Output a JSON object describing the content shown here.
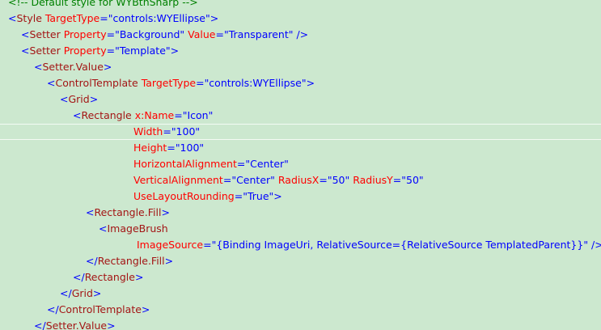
{
  "editor": {
    "colors": {
      "background": "#cce8cf",
      "comment": "#008000",
      "bracket": "#0000ff",
      "tag": "#a31515",
      "attribute": "#ff0000",
      "value": "#0000ff",
      "current_line_border": "#f4fbf4"
    },
    "current_line_index": 8,
    "lines": [
      {
        "indent": 10,
        "tokens": [
          [
            "comment",
            "<!-- Default style for WYBtnSharp -->"
          ]
        ]
      },
      {
        "indent": 10,
        "tokens": [
          [
            "bracket",
            "<"
          ],
          [
            "tag",
            "Style"
          ],
          [
            "attr",
            " TargetType"
          ],
          [
            "bracket",
            "="
          ],
          [
            "value",
            "\"controls:WYEllipse\""
          ],
          [
            "bracket",
            ">"
          ]
        ]
      },
      {
        "indent": 26,
        "tokens": [
          [
            "bracket",
            "<"
          ],
          [
            "tag",
            "Setter"
          ],
          [
            "attr",
            " Property"
          ],
          [
            "bracket",
            "="
          ],
          [
            "value",
            "\"Background\""
          ],
          [
            "attr",
            " Value"
          ],
          [
            "bracket",
            "="
          ],
          [
            "value",
            "\"Transparent\""
          ],
          [
            "bracket",
            " />"
          ]
        ]
      },
      {
        "indent": 26,
        "tokens": [
          [
            "bracket",
            "<"
          ],
          [
            "tag",
            "Setter"
          ],
          [
            "attr",
            " Property"
          ],
          [
            "bracket",
            "="
          ],
          [
            "value",
            "\"Template\""
          ],
          [
            "bracket",
            ">"
          ]
        ]
      },
      {
        "indent": 42,
        "tokens": [
          [
            "bracket",
            "<"
          ],
          [
            "tag",
            "Setter.Value"
          ],
          [
            "bracket",
            ">"
          ]
        ]
      },
      {
        "indent": 58,
        "tokens": [
          [
            "bracket",
            "<"
          ],
          [
            "tag",
            "ControlTemplate"
          ],
          [
            "attr",
            " TargetType"
          ],
          [
            "bracket",
            "="
          ],
          [
            "value",
            "\"controls:WYEllipse\""
          ],
          [
            "bracket",
            ">"
          ]
        ]
      },
      {
        "indent": 74,
        "tokens": [
          [
            "bracket",
            "<"
          ],
          [
            "tag",
            "Grid"
          ],
          [
            "bracket",
            ">"
          ]
        ]
      },
      {
        "indent": 90,
        "tokens": [
          [
            "bracket",
            "<"
          ],
          [
            "tag",
            "Rectangle"
          ],
          [
            "attr",
            " x:Name"
          ],
          [
            "bracket",
            "="
          ],
          [
            "value",
            "\"Icon\""
          ]
        ]
      },
      {
        "indent": 165,
        "tokens": [
          [
            "attr",
            "Width"
          ],
          [
            "bracket",
            "="
          ],
          [
            "value",
            "\"100\""
          ]
        ]
      },
      {
        "indent": 165,
        "tokens": [
          [
            "attr",
            "Height"
          ],
          [
            "bracket",
            "="
          ],
          [
            "value",
            "\"100\""
          ]
        ]
      },
      {
        "indent": 165,
        "tokens": [
          [
            "attr",
            "HorizontalAlignment"
          ],
          [
            "bracket",
            "="
          ],
          [
            "value",
            "\"Center\""
          ]
        ]
      },
      {
        "indent": 165,
        "tokens": [
          [
            "attr",
            "VerticalAlignment"
          ],
          [
            "bracket",
            "="
          ],
          [
            "value",
            "\"Center\""
          ],
          [
            "attr",
            " RadiusX"
          ],
          [
            "bracket",
            "="
          ],
          [
            "value",
            "\"50\""
          ],
          [
            "attr",
            " RadiusY"
          ],
          [
            "bracket",
            "="
          ],
          [
            "value",
            "\"50\""
          ]
        ]
      },
      {
        "indent": 165,
        "tokens": [
          [
            "attr",
            "UseLayoutRounding"
          ],
          [
            "bracket",
            "="
          ],
          [
            "value",
            "\"True\""
          ],
          [
            "bracket",
            ">"
          ]
        ]
      },
      {
        "indent": 106,
        "tokens": [
          [
            "bracket",
            "<"
          ],
          [
            "tag",
            "Rectangle.Fill"
          ],
          [
            "bracket",
            ">"
          ]
        ]
      },
      {
        "indent": 122,
        "tokens": [
          [
            "bracket",
            "<"
          ],
          [
            "tag",
            "ImageBrush"
          ]
        ]
      },
      {
        "indent": 169,
        "tokens": [
          [
            "attr",
            "ImageSource"
          ],
          [
            "bracket",
            "="
          ],
          [
            "value",
            "\"{Binding ImageUri, RelativeSource={RelativeSource TemplatedParent}}\""
          ],
          [
            "bracket",
            " />"
          ]
        ]
      },
      {
        "indent": 106,
        "tokens": [
          [
            "bracket",
            "</"
          ],
          [
            "tag",
            "Rectangle.Fill"
          ],
          [
            "bracket",
            ">"
          ]
        ]
      },
      {
        "indent": 90,
        "tokens": [
          [
            "bracket",
            "</"
          ],
          [
            "tag",
            "Rectangle"
          ],
          [
            "bracket",
            ">"
          ]
        ]
      },
      {
        "indent": 74,
        "tokens": [
          [
            "bracket",
            "</"
          ],
          [
            "tag",
            "Grid"
          ],
          [
            "bracket",
            ">"
          ]
        ]
      },
      {
        "indent": 58,
        "tokens": [
          [
            "bracket",
            "</"
          ],
          [
            "tag",
            "ControlTemplate"
          ],
          [
            "bracket",
            ">"
          ]
        ]
      },
      {
        "indent": 42,
        "tokens": [
          [
            "bracket",
            "</"
          ],
          [
            "tag",
            "Setter.Value"
          ],
          [
            "bracket",
            ">"
          ]
        ]
      }
    ]
  }
}
